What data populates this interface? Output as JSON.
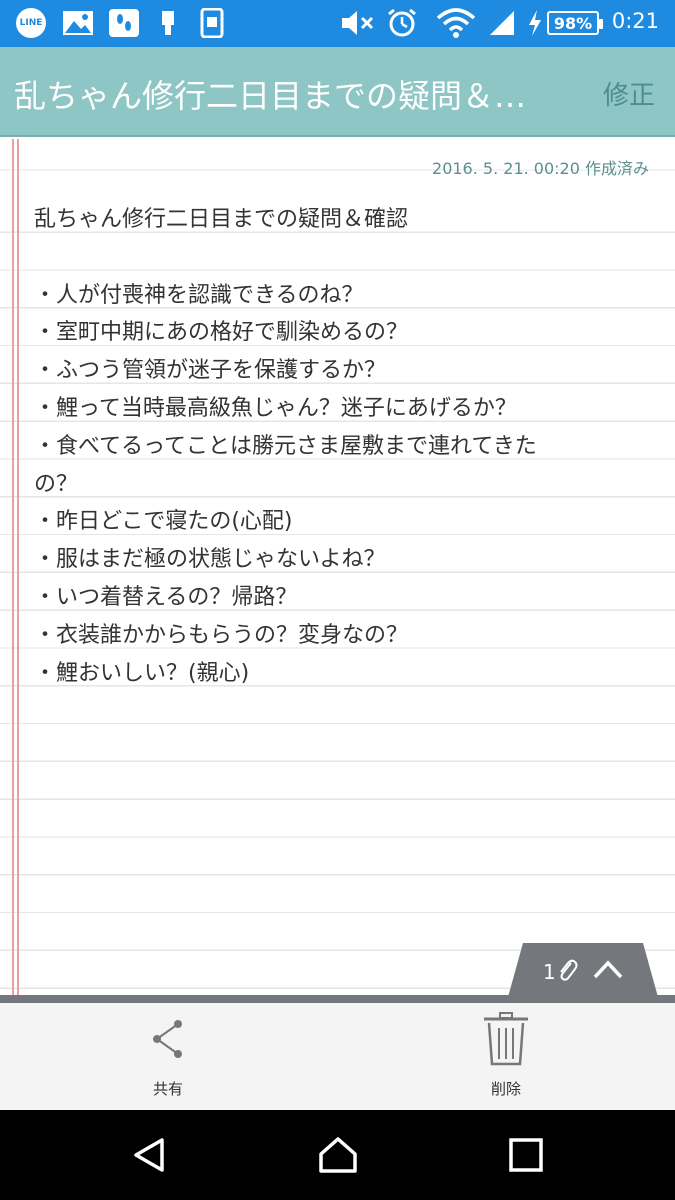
{
  "status_bar": {
    "line_label": "LINE",
    "battery": "98%",
    "time": "0:21",
    "icons": [
      "line-icon",
      "gallery-icon",
      "steps-icon",
      "sim-icon",
      "phone-icon",
      "mute-icon",
      "alarm-icon",
      "wifi-icon",
      "signal-icon",
      "charging-icon",
      "battery-icon"
    ]
  },
  "app_bar": {
    "title": "乱ちゃん修行二日目までの疑問＆…",
    "edit_label": "修正",
    "background": "#8dc6c4"
  },
  "note": {
    "created": "2016. 5. 21. 00:20 作成済み",
    "lines": [
      "乱ちゃん修行二日目までの疑問＆確認",
      "",
      "・人が付喪神を認識できるのね？",
      "・室町中期にあの格好で馴染めるの？",
      "・ふつう管領が迷子を保護するか？",
      "・鯉って当時最高級魚じゃん？迷子にあげるか？",
      "・食べてるってことは勝元さま屋敷まで連れてきた",
      "の？",
      "・昨日どこで寝たの(心配)",
      "・服はまだ極の状態じゃないよね？",
      "・いつ着替えるの？帰路？",
      "・衣装誰かからもらうの？変身なの？",
      "・鯉おいしい？(親心)"
    ]
  },
  "attachment": {
    "count": "1",
    "icons": [
      "paperclip-icon",
      "chevron-up-icon"
    ]
  },
  "actions": {
    "share_label": "共有",
    "delete_label": "削除"
  },
  "nav_bar": {
    "icons": [
      "back-icon",
      "home-icon",
      "recents-icon"
    ]
  }
}
